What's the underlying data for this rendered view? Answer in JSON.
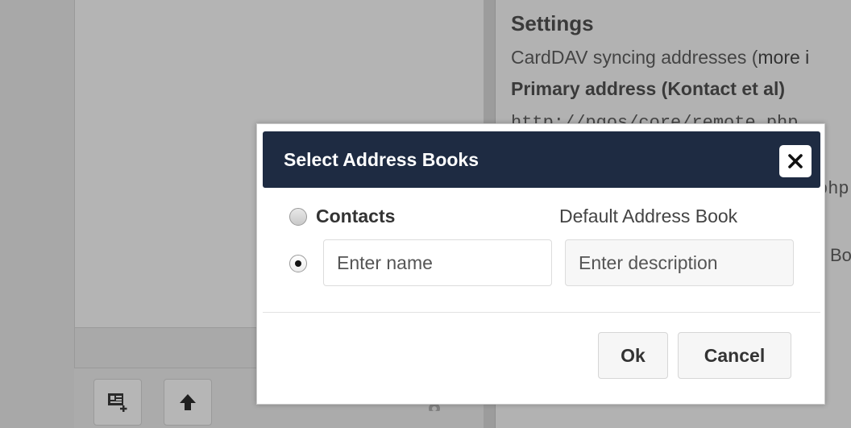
{
  "background": {
    "settings_heading": "Settings",
    "carddav_text": "CardDAV syncing addresses (",
    "more_link": "more i",
    "primary_heading": "Primary address (Kontact et al)",
    "url_fragment": "http://pgos/core/remote.php",
    "url_fragment_2": "php",
    "bo_fragment": "Bo"
  },
  "dialog": {
    "title": "Select Address Books",
    "options": [
      {
        "label": "Contacts",
        "description": "Default Address Book",
        "selected": false
      },
      {
        "selected": true
      }
    ],
    "name_placeholder": "Enter name",
    "description_placeholder": "Enter description",
    "ok_label": "Ok",
    "cancel_label": "Cancel"
  },
  "icons": {
    "close": "close-icon",
    "new_address_book": "add-address-book-icon",
    "upload": "upload-arrow-icon",
    "settings": "gear-icon"
  },
  "colors": {
    "titlebar": "#1e2b42",
    "overlay_bg": "#a8a8a8",
    "dialog_bg": "#ffffff"
  }
}
